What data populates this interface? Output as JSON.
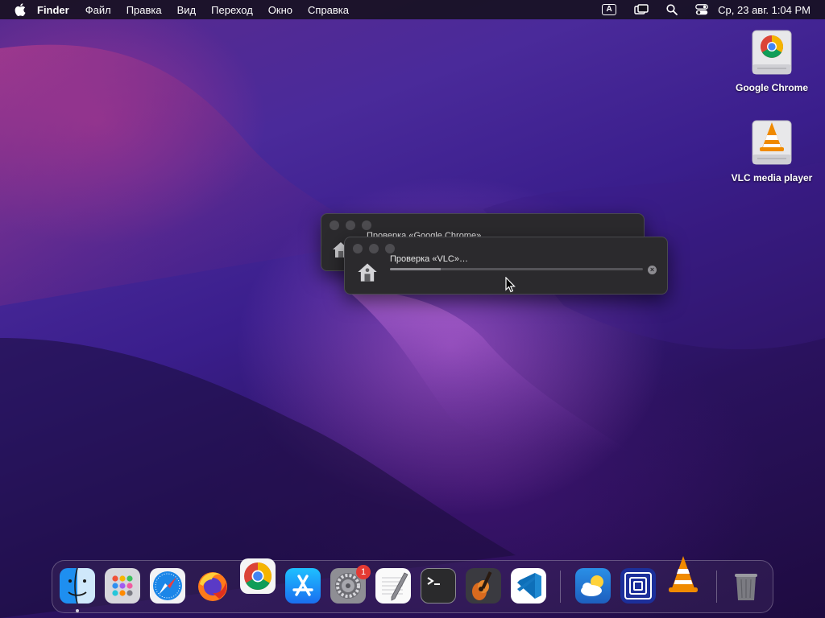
{
  "menubar": {
    "app_name": "Finder",
    "items": [
      "Файл",
      "Правка",
      "Вид",
      "Переход",
      "Окно",
      "Справка"
    ],
    "input_source": "A",
    "clock": "Ср, 23 авг.  1:04 PM"
  },
  "desktop_icons": [
    {
      "label": "Google Chrome",
      "icon": "chrome-drive-icon"
    },
    {
      "label": "VLC media player",
      "icon": "vlc-drive-icon"
    }
  ],
  "progress_windows": {
    "back": {
      "title": "Проверка «Google Chrome»…"
    },
    "front": {
      "title": "Проверка «VLC»…",
      "progress": 0.2
    }
  },
  "dock": {
    "items": [
      "finder",
      "launchpad",
      "safari",
      "firefox",
      "chrome",
      "app-store",
      "system-preferences",
      "textedit",
      "terminal",
      "garageband",
      "vscode",
      "weather",
      "screenflow",
      "vlc",
      "trash"
    ],
    "system_preferences_badge": "1"
  },
  "colors": {
    "menubar_bg": "#14101c",
    "window_bg": "#2b2a2d",
    "badge_red": "#e53a33"
  }
}
